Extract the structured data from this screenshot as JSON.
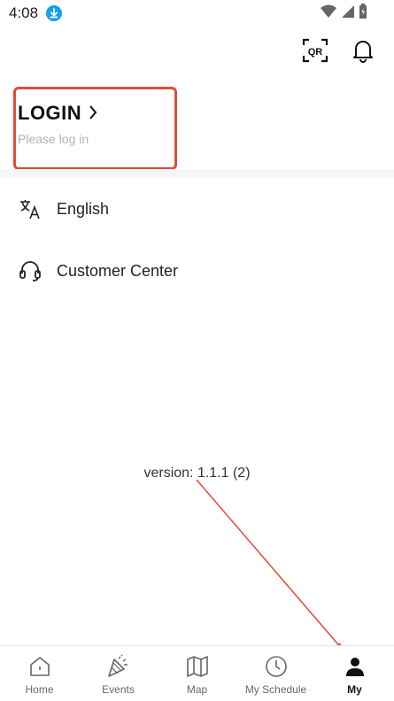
{
  "status_bar": {
    "time": "4:08"
  },
  "header": {
    "qr_label": "QR"
  },
  "login": {
    "title": "LOGIN",
    "subtitle": "Please log in"
  },
  "menu": [
    {
      "label": "English",
      "icon": "translate-icon"
    },
    {
      "label": "Customer Center",
      "icon": "headset-icon"
    }
  ],
  "version": "version: 1.1.1 (2)",
  "tabs": [
    {
      "label": "Home",
      "icon": "home-icon"
    },
    {
      "label": "Events",
      "icon": "party-popper-icon"
    },
    {
      "label": "Map",
      "icon": "map-icon"
    },
    {
      "label": "My Schedule",
      "icon": "clock-icon"
    },
    {
      "label": "My",
      "icon": "person-icon",
      "active": true
    }
  ],
  "colors": {
    "annotation": "#e04b36",
    "download_badge": "#11a3e8"
  }
}
